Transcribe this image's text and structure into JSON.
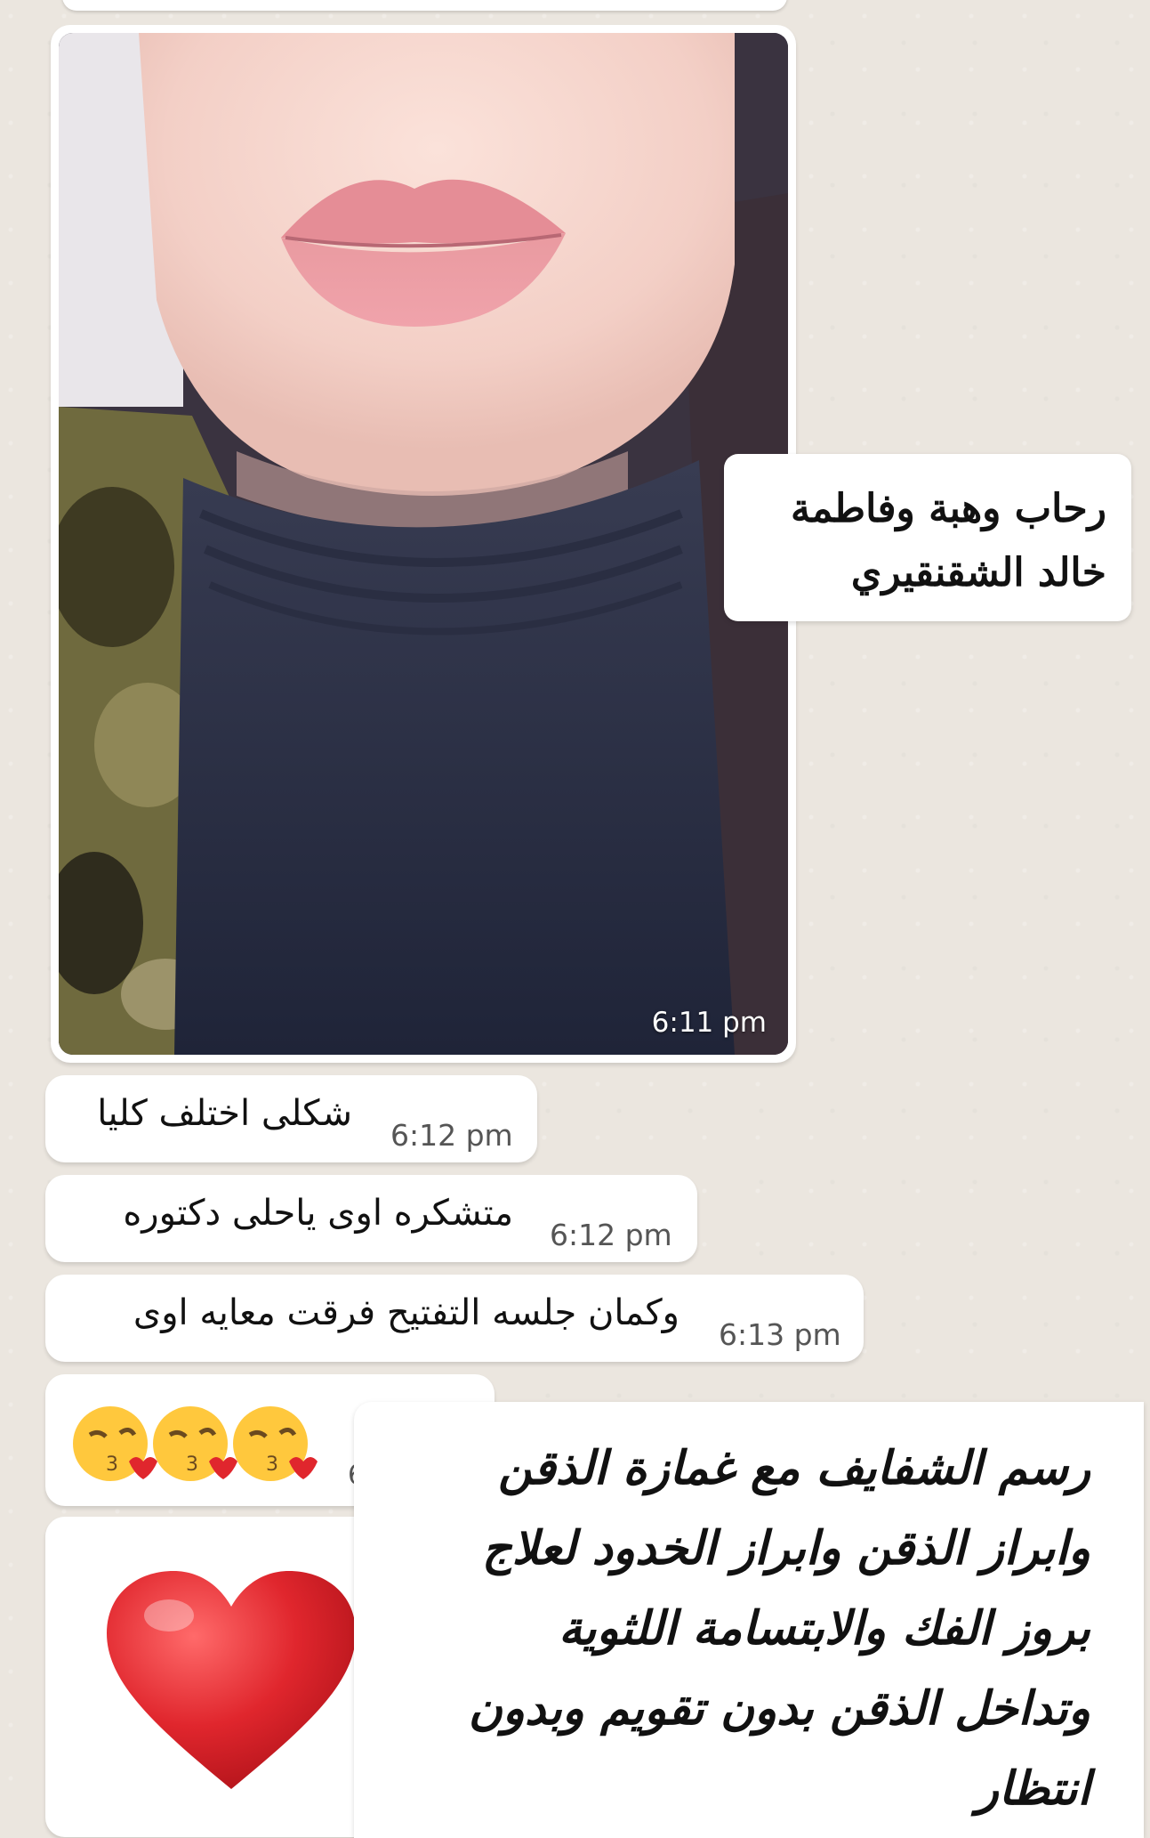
{
  "chat": {
    "photo_message": {
      "time": "6:11 pm"
    },
    "messages": [
      {
        "text": "شكلى اختلف كليا",
        "time": "6:12 pm"
      },
      {
        "text": "متشكره اوى ياحلى دكتوره",
        "time": "6:12 pm"
      },
      {
        "text": "وكمان جلسه التفتيح فرقت معايه اوى",
        "time": "6:13 pm"
      }
    ],
    "emoji_message": {
      "emojis": [
        "face-blowing-kiss",
        "face-blowing-kiss",
        "face-blowing-kiss"
      ],
      "partial_time": "6"
    },
    "heart_message": {
      "emoji": "red-heart"
    }
  },
  "overlay_names": {
    "line1": "رحاب وهبة وفاطمة",
    "line2": "خالد الشقنقيري"
  },
  "overlay_promo": {
    "lines": [
      "رسم الشفايف مع غمازة الذقن",
      "وابراز الذقن وابراز الخدود لعلاج",
      "بروز الفك والابتسامة اللثوية",
      "وتداخل الذقن بدون تقويم وبدون",
      "انتظار"
    ]
  },
  "colors": {
    "chat_background": "#ebe6df",
    "bubble": "#ffffff",
    "heart": "#e0262d",
    "emoji_face": "#ffc83d"
  }
}
